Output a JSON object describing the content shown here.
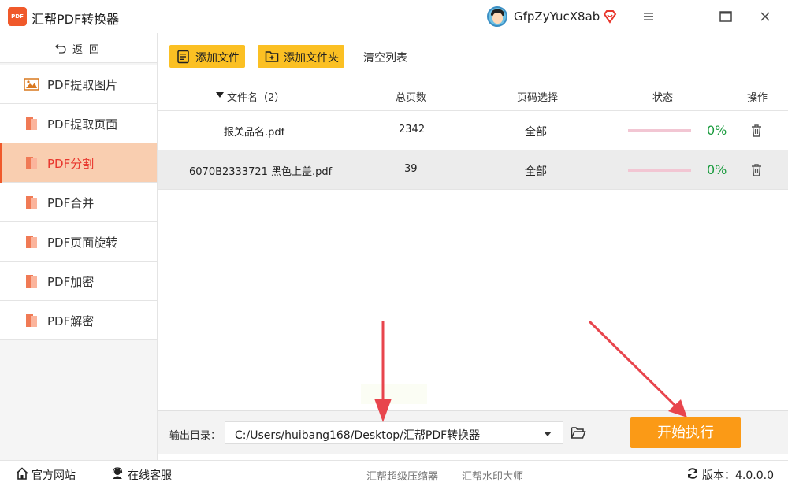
{
  "app": {
    "logo_text": "PDF",
    "title": "汇帮PDF转换器",
    "username": "GfpZyYucX8ab"
  },
  "icons": {
    "vip": "diamond-heart-icon",
    "menu": "hamburger-menu-icon",
    "maximize": "maximize-icon",
    "close": "close-icon",
    "back": "undo-arrow-icon",
    "image": "image-icon",
    "pdf": "pdf-file-icon",
    "add_file": "file-list-icon",
    "add_folder": "folder-plus-icon",
    "trash": "trash-icon",
    "folder": "folder-open-icon",
    "home": "home-icon",
    "support": "headset-icon",
    "refresh": "refresh-icon"
  },
  "colors": {
    "accent": "#f0592a",
    "active_bg": "#f9ceb0",
    "active_text": "#e8362c",
    "button_yellow": "#fbc023",
    "start_orange": "#fb9a16",
    "progress_green": "#1a9b3e",
    "arrow_red": "#e8454d"
  },
  "sidebar": {
    "back_label": "返回",
    "items": [
      {
        "label": "PDF提取图片",
        "icon": "image-icon",
        "active": false
      },
      {
        "label": "PDF提取页面",
        "icon": "pdf-file-icon",
        "active": false
      },
      {
        "label": "PDF分割",
        "icon": "pdf-file-icon",
        "active": true
      },
      {
        "label": "PDF合并",
        "icon": "pdf-file-icon",
        "active": false
      },
      {
        "label": "PDF页面旋转",
        "icon": "pdf-file-icon",
        "active": false
      },
      {
        "label": "PDF加密",
        "icon": "pdf-file-icon",
        "active": false
      },
      {
        "label": "PDF解密",
        "icon": "pdf-file-icon",
        "active": false
      }
    ]
  },
  "toolbar": {
    "add_file": "添加文件",
    "add_folder": "添加文件夹",
    "clear_list": "清空列表"
  },
  "table": {
    "columns": [
      "文件名（2）",
      "总页数",
      "页码选择",
      "状态",
      "操作"
    ],
    "rows": [
      {
        "filename": "报关品名.pdf",
        "pages": "2342",
        "page_select": "全部",
        "progress": 0,
        "progress_label": "0%"
      },
      {
        "filename": "6070B2333721 黑色上盖.pdf",
        "pages": "39",
        "page_select": "全部",
        "progress": 0,
        "progress_label": "0%"
      }
    ]
  },
  "output": {
    "label": "输出目录：",
    "path": "C:/Users/huibang168/Desktop/汇帮PDF转换器",
    "start_label": "开始执行"
  },
  "footer": {
    "website": "官方网站",
    "support": "在线客服",
    "link1": "汇帮超级压缩器",
    "link2": "汇帮水印大师",
    "version": "版本：4.0.0.0"
  }
}
